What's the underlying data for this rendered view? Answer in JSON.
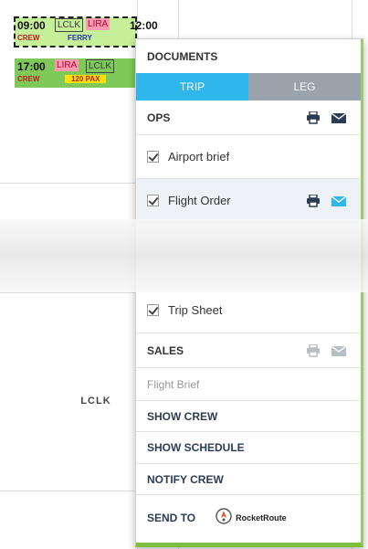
{
  "schedule": {
    "airport_label": "LCLK",
    "flights": [
      {
        "time": "09:00",
        "time_end": "12:00",
        "codes": [
          "LCLK",
          "LIRA"
        ],
        "crew": "CREW",
        "tag": "FERRY"
      },
      {
        "time": "17:00",
        "codes": [
          "LIRA",
          "LCLK"
        ],
        "crew": "CREW",
        "tag": "120 PAX"
      }
    ]
  },
  "menu": {
    "documents_title": "DOCUMENTS",
    "tabs": [
      {
        "label": "TRIP",
        "active": true
      },
      {
        "label": "LEG",
        "active": false
      }
    ],
    "ops_label": "OPS",
    "items": [
      {
        "label": "Airport brief"
      },
      {
        "label": "Flight Order"
      },
      {
        "label": "Trip Sheet"
      }
    ],
    "sales_label": "SALES",
    "flight_brief_label": "Flight Brief",
    "show_crew_label": "SHOW CREW",
    "show_schedule_label": "SHOW SCHEDULE",
    "notify_crew_label": "NOTIFY CREW",
    "send_to_label": "SEND TO",
    "rocketroute_label": "RocketRoute"
  },
  "icons": {
    "print": "printer-icon",
    "email": "envelope-icon"
  },
  "colors": {
    "tab_active": "#2fb6ec",
    "tab_inactive": "#9aa2ac",
    "menu_accent": "#7fbf3f",
    "envelope_active": "#2fb6ec",
    "envelope_dark": "#2b3d55",
    "disabled": "#b8bec6"
  }
}
